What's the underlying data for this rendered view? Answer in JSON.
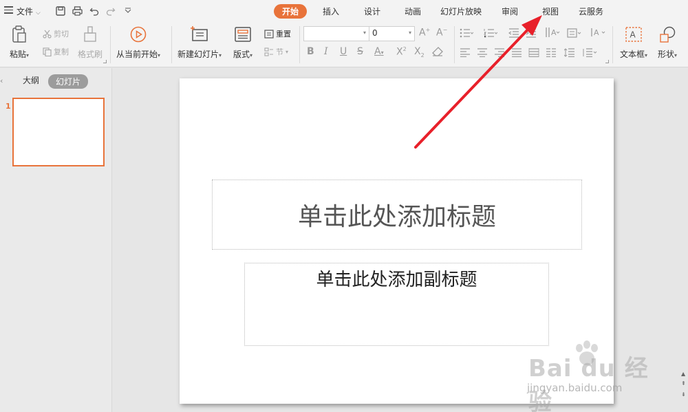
{
  "quick_access": {
    "file_menu": "文件",
    "icons": [
      "menu-icon",
      "save-icon",
      "print-icon",
      "undo-icon",
      "redo-icon",
      "customize-icon"
    ]
  },
  "tabs": [
    {
      "label": "开始",
      "active": true
    },
    {
      "label": "插入",
      "active": false
    },
    {
      "label": "设计",
      "active": false
    },
    {
      "label": "动画",
      "active": false
    },
    {
      "label": "幻灯片放映",
      "active": false
    },
    {
      "label": "审阅",
      "active": false
    },
    {
      "label": "视图",
      "active": false
    },
    {
      "label": "云服务",
      "active": false
    }
  ],
  "ribbon": {
    "paste": "粘贴",
    "cut": "剪切",
    "copy": "复制",
    "format_painter": "格式刷",
    "from_current": "从当前开始",
    "new_slide": "新建幻灯片",
    "layout": "版式",
    "reset": "重置",
    "section": "节",
    "font_name": "",
    "font_size": "0",
    "text_box": "文本框",
    "shape": "形状"
  },
  "left_panel": {
    "tab_outline": "大纲",
    "tab_slides": "幻灯片",
    "slide_number": "1"
  },
  "slide": {
    "title_placeholder": "单击此处添加标题",
    "subtitle_placeholder": "单击此处添加副标题"
  },
  "watermark": {
    "brand": "Bai du 经验",
    "url": "jingyan.baidu.com"
  },
  "colors": {
    "accent": "#e8733a",
    "annotation_arrow": "#e8202a"
  }
}
